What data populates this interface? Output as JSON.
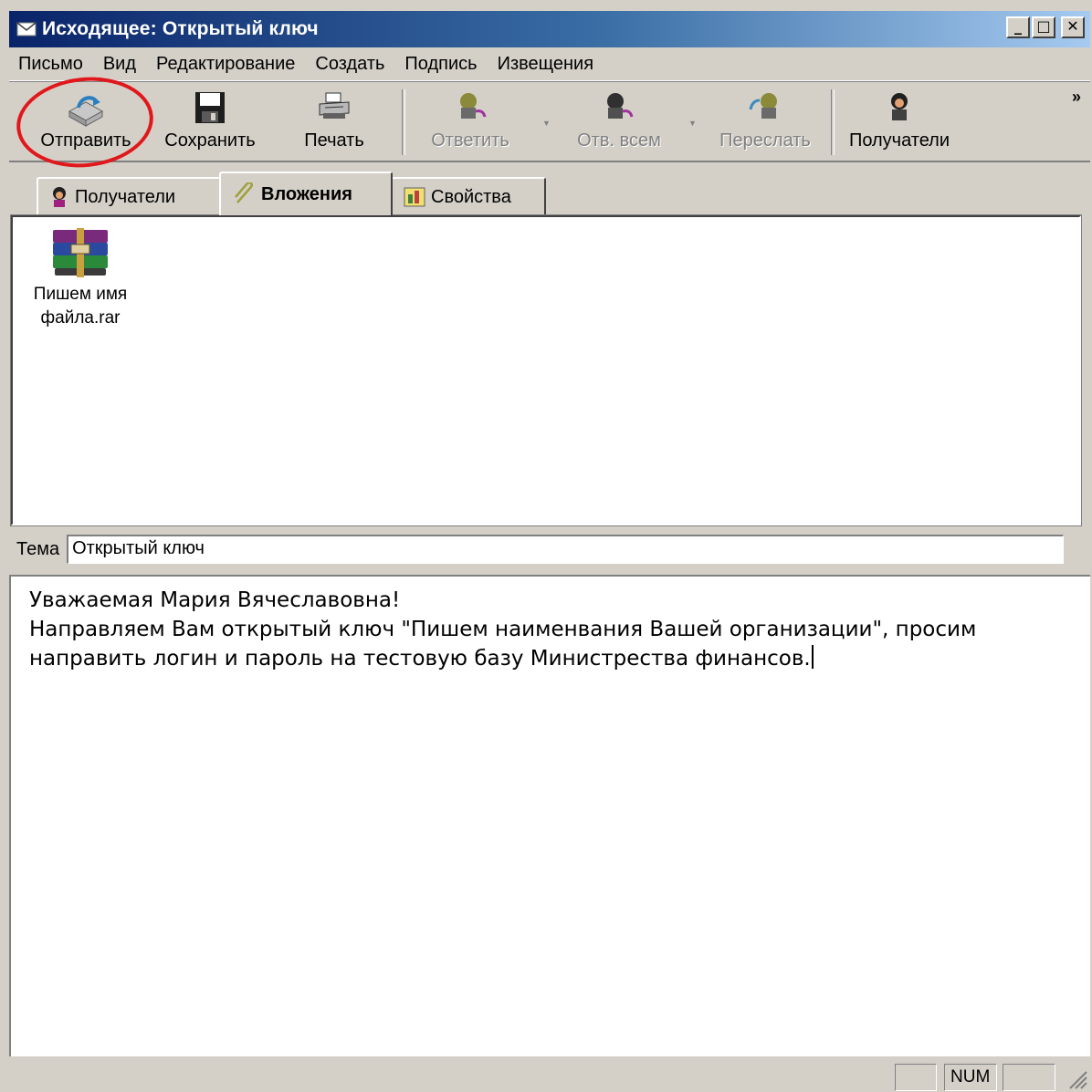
{
  "window": {
    "title": "Исходящее: Открытый ключ"
  },
  "menu": [
    "Письмо",
    "Вид",
    "Редактирование",
    "Создать",
    "Подпись",
    "Извещения"
  ],
  "toolbar": {
    "send_label": "Отправить",
    "save_label": "Сохранить",
    "print_label": "Печать",
    "reply_label": "Ответить",
    "reply_all_label": "Отв. всем",
    "forward_label": "Переслать",
    "recipients_label": "Получатели",
    "more": "»"
  },
  "tabs": {
    "recipients": "Получатели",
    "attachments": "Вложения",
    "properties": "Свойства"
  },
  "attachment": {
    "name_line1": "Пишем имя",
    "name_line2": "файла.rar"
  },
  "subject": {
    "label": "Тема",
    "value": "Открытый ключ"
  },
  "body": {
    "line1": "Уважаемая Мария Вячеславовна!",
    "line2": "Направляем Вам открытый ключ \"Пишем наименвания Вашей организации\", просим",
    "line3": "направить логин и пароль на тестовую базу Министрества финансов."
  },
  "status": {
    "num": "NUM"
  },
  "colors": {
    "titlebar": "#0a246a",
    "highlight": "#e0181c",
    "chrome": "#d4d0c8"
  }
}
